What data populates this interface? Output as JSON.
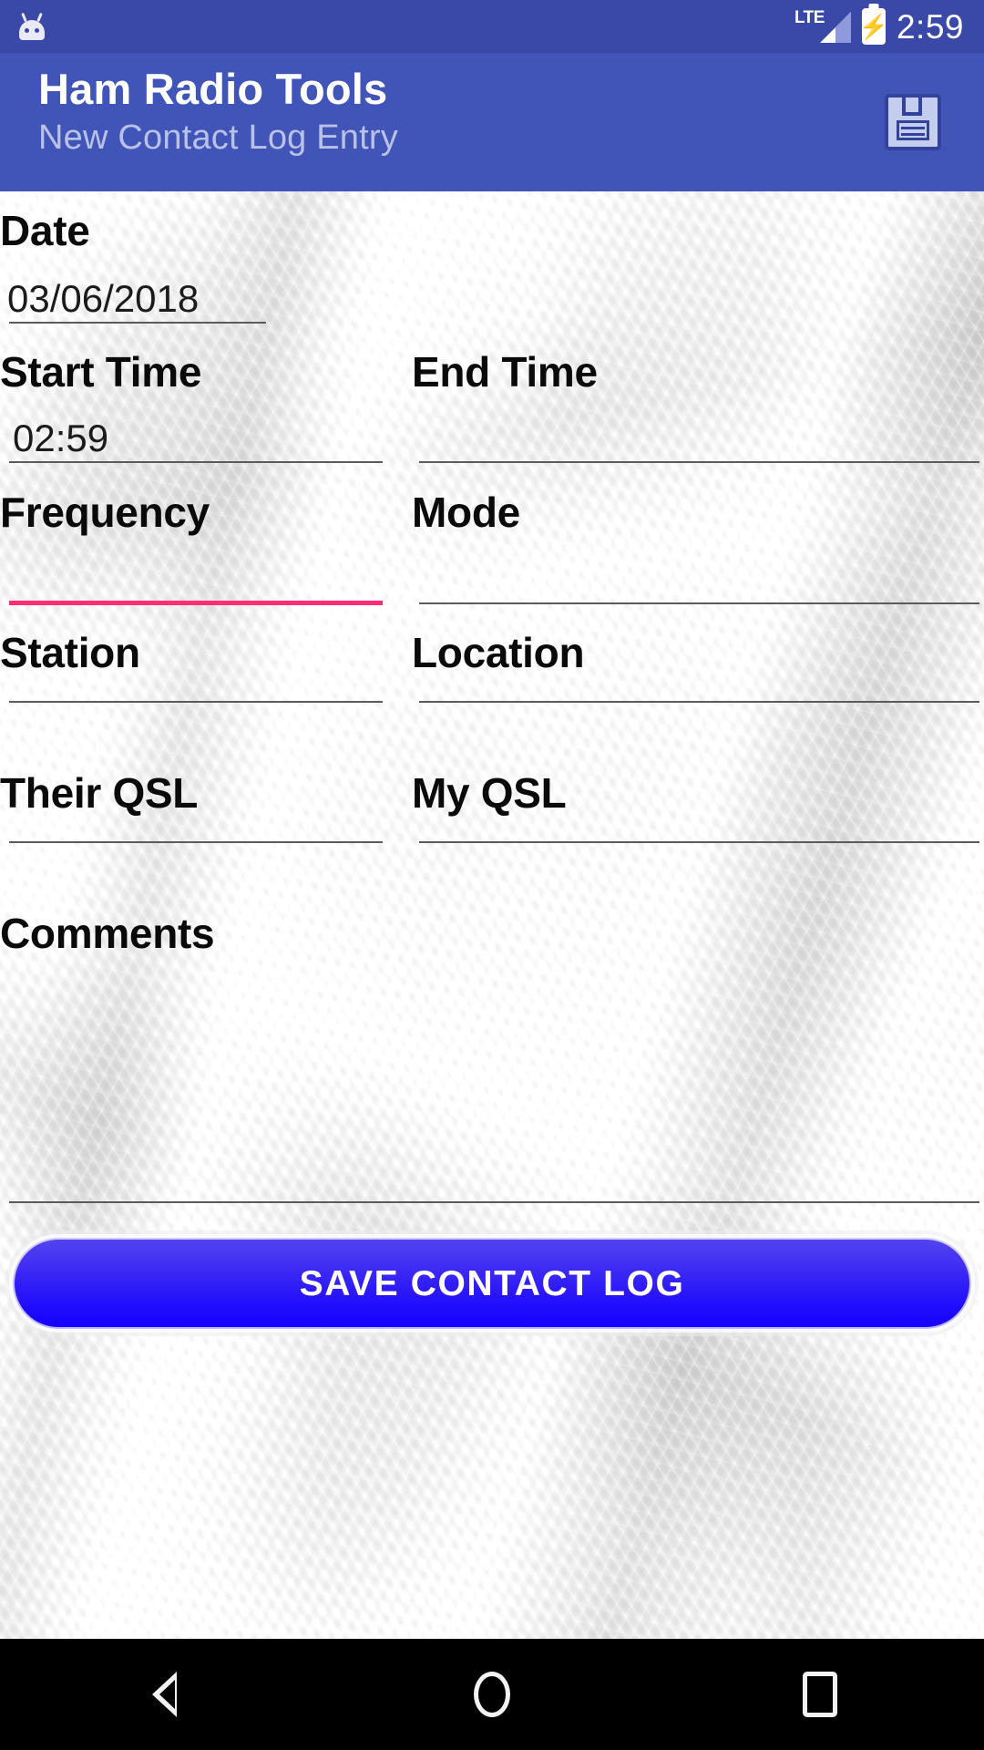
{
  "status_bar": {
    "notification_icon": "android-head-icon",
    "network_label": "LTE",
    "signal_icon": "signal-bars-icon",
    "battery_icon": "battery-charging-icon",
    "clock": "2:59"
  },
  "app_bar": {
    "title": "Ham Radio Tools",
    "subtitle": "New Contact Log Entry",
    "save_action_icon": "floppy-disk-save-icon",
    "background_color": "#4154b8",
    "title_color": "#ffffff",
    "subtitle_color": "#b9c2e6"
  },
  "form": {
    "fields": [
      {
        "key": "date",
        "label": "Date",
        "value": "03/06/2018",
        "focused": false
      },
      {
        "key": "start_time",
        "label": "Start Time",
        "value": "02:59",
        "focused": false
      },
      {
        "key": "end_time",
        "label": "End Time",
        "value": "",
        "focused": false
      },
      {
        "key": "frequency",
        "label": "Frequency",
        "value": "",
        "focused": true
      },
      {
        "key": "mode",
        "label": "Mode",
        "value": "",
        "focused": false
      },
      {
        "key": "station",
        "label": "Station",
        "value": "",
        "focused": false
      },
      {
        "key": "location",
        "label": "Location",
        "value": "",
        "focused": false
      },
      {
        "key": "their_qsl",
        "label": "Their QSL",
        "value": "",
        "focused": false
      },
      {
        "key": "my_qsl",
        "label": "My QSL",
        "value": "",
        "focused": false
      },
      {
        "key": "comments",
        "label": "Comments",
        "value": "",
        "focused": false
      }
    ],
    "focus_underline_color": "#ff2d73",
    "underline_color": "#5b5b5b"
  },
  "save_button": {
    "label": "SAVE CONTACT LOG",
    "gradient_top": "#5346ef",
    "gradient_bottom": "#1400ff",
    "text_color": "#ffffff"
  },
  "nav_bar": {
    "back_icon": "triangle-back-icon",
    "home_icon": "circle-home-icon",
    "recents_icon": "square-recents-icon"
  }
}
